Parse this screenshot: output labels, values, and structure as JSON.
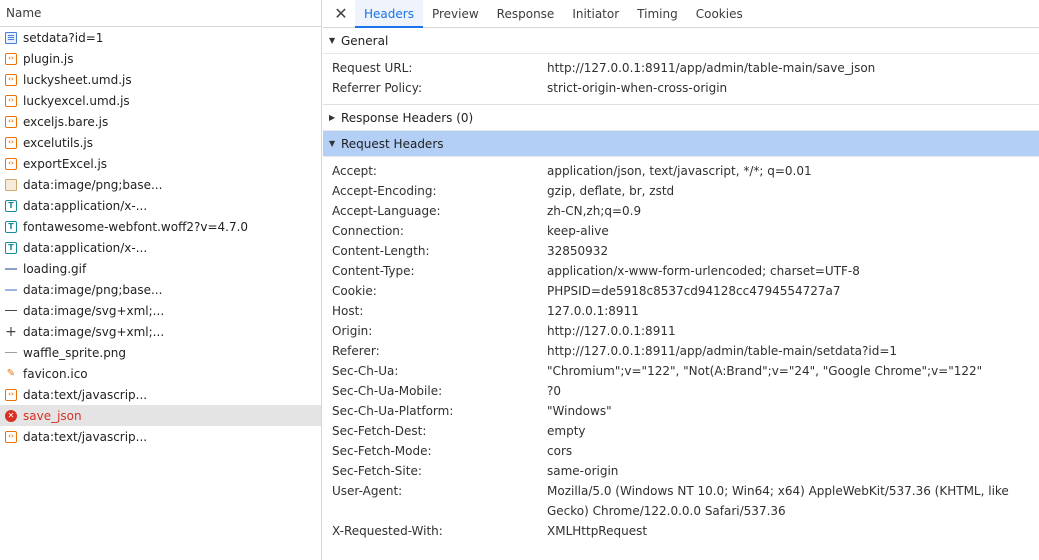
{
  "left_header": "Name",
  "requests": [
    {
      "name": "setdata?id=1",
      "icon": "document-icon",
      "kind": "doc"
    },
    {
      "name": "plugin.js",
      "icon": "script-icon",
      "kind": "script"
    },
    {
      "name": "luckysheet.umd.js",
      "icon": "script-icon",
      "kind": "script"
    },
    {
      "name": "luckyexcel.umd.js",
      "icon": "script-icon",
      "kind": "script"
    },
    {
      "name": "exceljs.bare.js",
      "icon": "script-icon",
      "kind": "script"
    },
    {
      "name": "excelutils.js",
      "icon": "script-icon",
      "kind": "script"
    },
    {
      "name": "exportExcel.js",
      "icon": "script-icon",
      "kind": "script"
    },
    {
      "name": "data:image/png;base...",
      "icon": "image-icon",
      "kind": "img"
    },
    {
      "name": "data:application/x-...",
      "icon": "font-icon",
      "kind": "font"
    },
    {
      "name": "fontawesome-webfont.woff2?v=4.7.0",
      "icon": "font-icon",
      "kind": "font"
    },
    {
      "name": "data:application/x-...",
      "icon": "font-icon",
      "kind": "font"
    },
    {
      "name": "loading.gif",
      "icon": "gif-icon",
      "kind": "gif"
    },
    {
      "name": "data:image/png;base...",
      "icon": "dash-image-icon",
      "kind": "dash"
    },
    {
      "name": "data:image/svg+xml;...",
      "icon": "line-image-icon",
      "kind": "line"
    },
    {
      "name": "data:image/svg+xml;...",
      "icon": "plus-image-icon",
      "kind": "plus"
    },
    {
      "name": "waffle_sprite.png",
      "icon": "thin-image-icon",
      "kind": "thin"
    },
    {
      "name": "favicon.ico",
      "icon": "favicon-icon",
      "kind": "fav"
    },
    {
      "name": "data:text/javascrip...",
      "icon": "script-icon",
      "kind": "script"
    },
    {
      "name": "save_json",
      "icon": "error-icon",
      "kind": "err",
      "selected": true,
      "error": true
    },
    {
      "name": "data:text/javascrip...",
      "icon": "script-icon",
      "kind": "script"
    }
  ],
  "tabs": {
    "close": "✕",
    "headers": "Headers",
    "preview": "Preview",
    "response": "Response",
    "initiator": "Initiator",
    "timing": "Timing",
    "cookies": "Cookies"
  },
  "general": {
    "title": "General",
    "rows": [
      {
        "k": "Request URL:",
        "v": "http://127.0.0.1:8911/app/admin/table-main/save_json"
      },
      {
        "k": "Referrer Policy:",
        "v": "strict-origin-when-cross-origin"
      }
    ]
  },
  "response_headers": {
    "title": "Response Headers (0)"
  },
  "request_headers": {
    "title": "Request Headers",
    "rows": [
      {
        "k": "Accept:",
        "v": "application/json, text/javascript, */*; q=0.01"
      },
      {
        "k": "Accept-Encoding:",
        "v": "gzip, deflate, br, zstd"
      },
      {
        "k": "Accept-Language:",
        "v": "zh-CN,zh;q=0.9"
      },
      {
        "k": "Connection:",
        "v": "keep-alive"
      },
      {
        "k": "Content-Length:",
        "v": "32850932"
      },
      {
        "k": "Content-Type:",
        "v": "application/x-www-form-urlencoded; charset=UTF-8"
      },
      {
        "k": "Cookie:",
        "v": "PHPSID=de5918c8537cd94128cc4794554727a7"
      },
      {
        "k": "Host:",
        "v": "127.0.0.1:8911"
      },
      {
        "k": "Origin:",
        "v": "http://127.0.0.1:8911"
      },
      {
        "k": "Referer:",
        "v": "http://127.0.0.1:8911/app/admin/table-main/setdata?id=1"
      },
      {
        "k": "Sec-Ch-Ua:",
        "v": "\"Chromium\";v=\"122\", \"Not(A:Brand\";v=\"24\", \"Google Chrome\";v=\"122\""
      },
      {
        "k": "Sec-Ch-Ua-Mobile:",
        "v": "?0"
      },
      {
        "k": "Sec-Ch-Ua-Platform:",
        "v": "\"Windows\""
      },
      {
        "k": "Sec-Fetch-Dest:",
        "v": "empty"
      },
      {
        "k": "Sec-Fetch-Mode:",
        "v": "cors"
      },
      {
        "k": "Sec-Fetch-Site:",
        "v": "same-origin"
      },
      {
        "k": "User-Agent:",
        "v": "Mozilla/5.0 (Windows NT 10.0; Win64; x64) AppleWebKit/537.36 (KHTML, like Gecko) Chrome/122.0.0.0 Safari/537.36"
      },
      {
        "k": "X-Requested-With:",
        "v": "XMLHttpRequest"
      }
    ]
  },
  "colors": {
    "accent": "#1a73e8",
    "error": "#d93025",
    "section_highlight": "#b3cff5",
    "selected_row": "#e4e4e4"
  }
}
